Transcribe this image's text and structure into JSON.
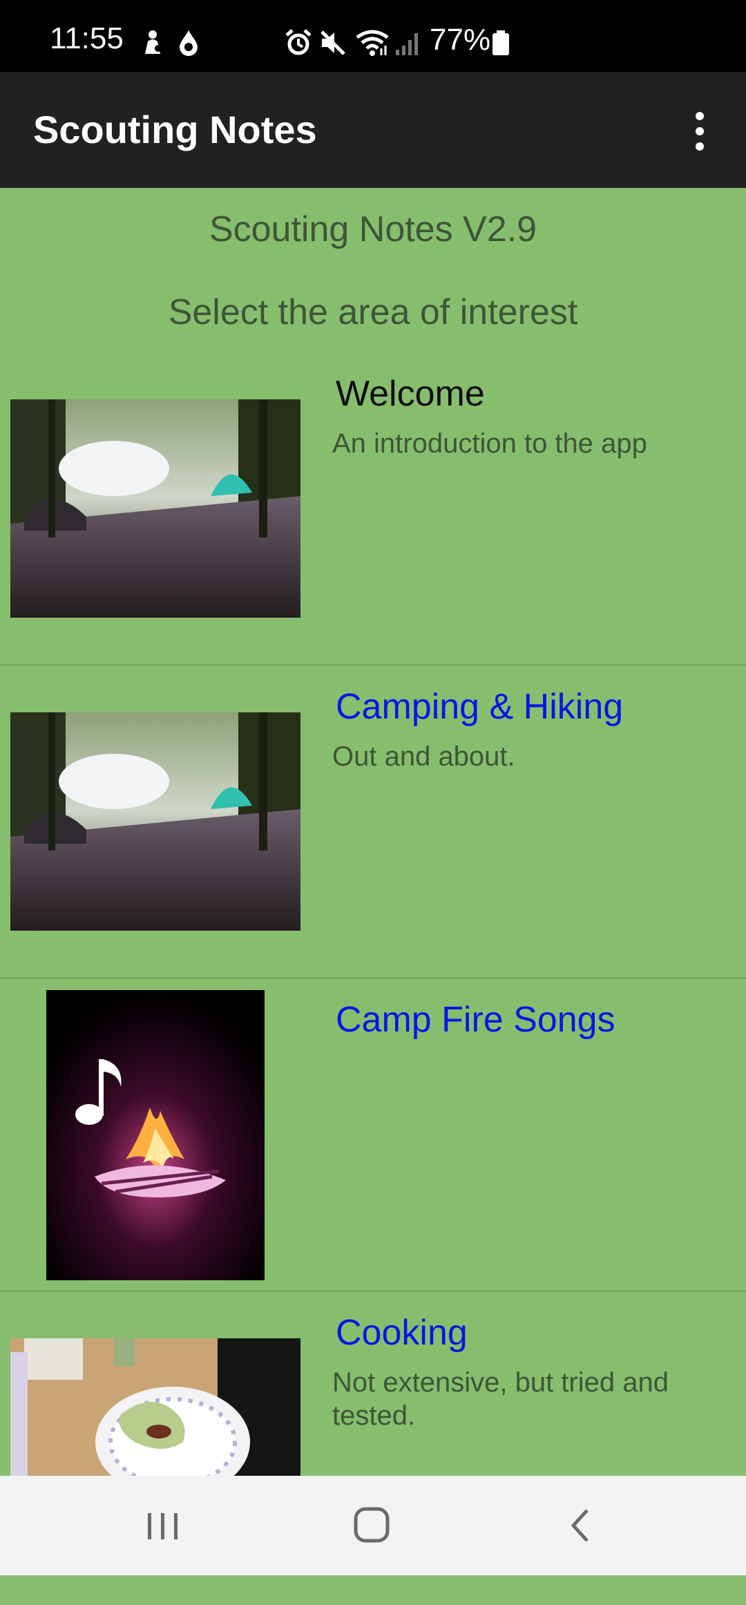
{
  "status_bar": {
    "time": "11:55",
    "battery_percent": "77%",
    "icons": [
      "notification-person-icon",
      "drop-icon",
      "alarm-icon",
      "mute-icon",
      "wifi-icon",
      "signal-icon",
      "battery-icon"
    ]
  },
  "app_bar": {
    "title": "Scouting Notes",
    "menu_icon": "overflow-menu-icon"
  },
  "header": {
    "version": "Scouting Notes V2.9",
    "prompt": "Select the area of interest"
  },
  "items": [
    {
      "title": "Welcome",
      "description": "An introduction to the app",
      "is_link": false,
      "image": "campsite-photo"
    },
    {
      "title": "Camping & Hiking",
      "description": "Out and about.",
      "is_link": true,
      "image": "campsite-photo"
    },
    {
      "title": "Camp Fire Songs",
      "description": "",
      "is_link": true,
      "image": "campfire-music-photo"
    },
    {
      "title": "Cooking",
      "description": "Not extensive, but tried and tested.",
      "is_link": true,
      "image": "cooking-plate-photo"
    }
  ],
  "nav_bar": {
    "buttons": [
      "recent-apps-icon",
      "home-icon",
      "back-icon"
    ]
  },
  "colors": {
    "background": "#86be6e",
    "app_bar": "#212121",
    "link": "#0a14e6",
    "secondary_text": "#3f5537"
  }
}
